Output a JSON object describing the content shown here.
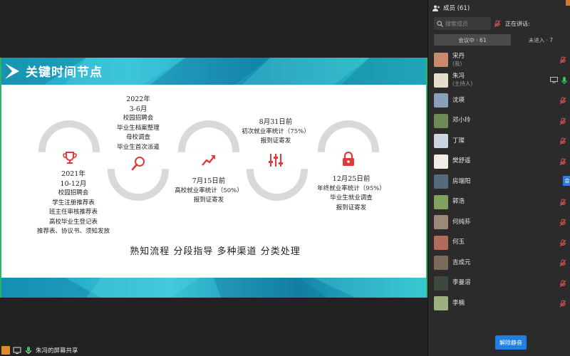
{
  "slide": {
    "title": "关键时间节点",
    "slogan": "熟知流程   分段指导   多种渠道   分类处理",
    "nodes": [
      {
        "lines": [
          "2021年",
          "10-12月",
          "校园招聘会",
          "学生注册推荐表",
          "班主任审核推荐表",
          "高校毕业生登记表",
          "推荐表、协议书、须知发放"
        ],
        "icon": "trophy-icon"
      },
      {
        "lines": [
          "2022年",
          "3-6月",
          "校园招聘会",
          "毕业生档案整理",
          "母校调查",
          "毕业生首次派遣"
        ],
        "icon": "search-icon"
      },
      {
        "lines": [
          "7月15日前",
          "高校就业率统计（50%）",
          "报到证寄发"
        ],
        "icon": "trend-up-icon"
      },
      {
        "lines": [
          "8月31日前",
          "初次就业率统计（75%）",
          "报到证寄发"
        ],
        "icon": "sliders-icon"
      },
      {
        "lines": [
          "12月25日前",
          "年终就业率统计（95%）",
          "毕业生就业调查",
          "报到证寄发"
        ],
        "icon": "lock-icon"
      }
    ]
  },
  "share_label": "朱冯的屏幕共享",
  "panel": {
    "header": "成员 (61)",
    "search_placeholder": "搜索成员",
    "speaking_label": "正在讲话:",
    "tabs": [
      {
        "label": "会议中 · 61",
        "active": true
      },
      {
        "label": "未进入 · 7",
        "active": false
      }
    ],
    "members": [
      {
        "name": "宋丹",
        "role": "(我)",
        "mic": "muted"
      },
      {
        "name": "朱冯",
        "role": "(主持人)",
        "mic": "on",
        "sharing": true
      },
      {
        "name": "沈瑛",
        "role": "",
        "mic": "muted"
      },
      {
        "name": "邓小玲",
        "role": "",
        "mic": "muted"
      },
      {
        "name": "丁璨",
        "role": "",
        "mic": "muted"
      },
      {
        "name": "樊舒遥",
        "role": "",
        "mic": "muted"
      },
      {
        "name": "房端阳",
        "role": "",
        "mic": "none",
        "badge": "会"
      },
      {
        "name": "郭浩",
        "role": "",
        "mic": "muted"
      },
      {
        "name": "何纯荪",
        "role": "",
        "mic": "muted"
      },
      {
        "name": "何玉",
        "role": "",
        "mic": "muted"
      },
      {
        "name": "吉成元",
        "role": "",
        "mic": "muted"
      },
      {
        "name": "李曼溶",
        "role": "",
        "mic": "muted"
      },
      {
        "name": "李楠",
        "role": "",
        "mic": "muted"
      }
    ],
    "unmute_all_label": "解除静音"
  },
  "colors": {
    "accent": "#1f7fe5",
    "slide_teal": "#1aa6c7",
    "icon_red": "#e03b3b",
    "arc_grey": "#d9d9d9",
    "muted_red": "#d9534f",
    "mic_green": "#34c759"
  }
}
